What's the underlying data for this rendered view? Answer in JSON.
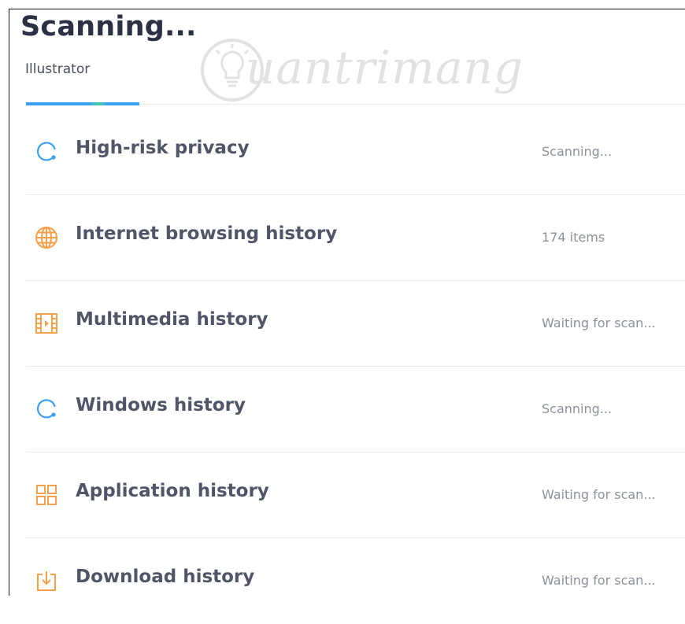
{
  "header": {
    "title": "Scanning...",
    "subtitle": "Illustrator"
  },
  "watermark": {
    "text": "uantrimang"
  },
  "progress": {
    "fraction": 0.17
  },
  "items": [
    {
      "label": "High-risk privacy",
      "status": "Scanning...",
      "icon": "spinner-icon"
    },
    {
      "label": "Internet browsing history",
      "status": "174 items",
      "icon": "globe-icon"
    },
    {
      "label": "Multimedia history",
      "status": "Waiting for scan...",
      "icon": "film-icon"
    },
    {
      "label": "Windows history",
      "status": "Scanning...",
      "icon": "spinner-icon"
    },
    {
      "label": "Application history",
      "status": "Waiting for scan...",
      "icon": "apps-grid-icon"
    },
    {
      "label": "Download history",
      "status": "Waiting for scan...",
      "icon": "download-icon"
    }
  ],
  "colors": {
    "title": "#2b3044",
    "label": "#505668",
    "status": "#8c919c",
    "accent_blue": "#3aa0f0",
    "accent_orange": "#f5a04a",
    "divider": "#e8ebef"
  }
}
